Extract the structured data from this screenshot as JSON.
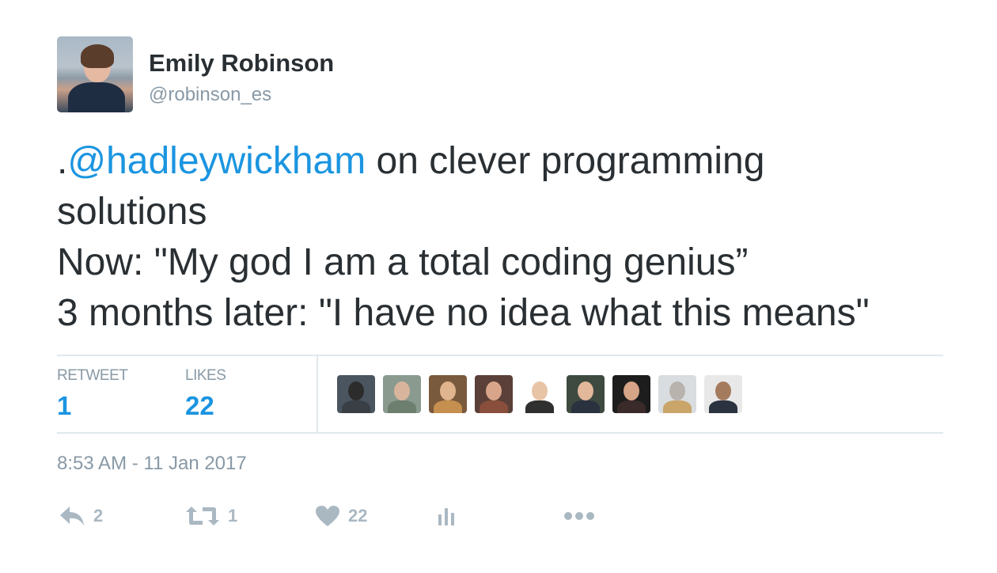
{
  "author": {
    "name": "Emily Robinson",
    "handle": "@robinson_es"
  },
  "tweet": {
    "prefix": ".",
    "mention": "@hadleywickham",
    "line1_rest": " on clever programming",
    "line2": "solutions",
    "line3": "Now: \"My god I am a total coding genius”",
    "line4": "3 months later: \"I have no idea what this means\""
  },
  "stats": {
    "retweet_label": "RETWEET",
    "retweet_count": "1",
    "likes_label": "LIKES",
    "likes_count": "22"
  },
  "likers": [
    {
      "bg": "#4a5560",
      "head": "#2c2c2c",
      "body": "#3a3f46"
    },
    {
      "bg": "#8a9a8f",
      "head": "#d9b49c",
      "body": "#6d7f6e"
    },
    {
      "bg": "#7a5a3c",
      "head": "#e0b58e",
      "body": "#c58f4f"
    },
    {
      "bg": "#5a4038",
      "head": "#d8a58a",
      "body": "#8a4f3c"
    },
    {
      "bg": "#ffffff",
      "head": "#e8c4a6",
      "body": "#2f2f2f"
    },
    {
      "bg": "#3e4a40",
      "head": "#e2b79a",
      "body": "#2a3240"
    },
    {
      "bg": "#1d1d1d",
      "head": "#d6a486",
      "body": "#3a2a2a"
    },
    {
      "bg": "#d9dde0",
      "head": "#b9b3ad",
      "body": "#c9a56a"
    },
    {
      "bg": "#e8e8e8",
      "head": "#a57b5e",
      "body": "#2b3340"
    }
  ],
  "timestamp": "8:53 AM - 11 Jan 2017",
  "actions": {
    "reply_count": "2",
    "retweet_count": "1",
    "like_count": "22"
  },
  "colors": {
    "link": "#1b95e0",
    "muted": "#8899a6",
    "icon": "#aab8c2",
    "text": "#292f33",
    "border": "#e1e8ed"
  }
}
